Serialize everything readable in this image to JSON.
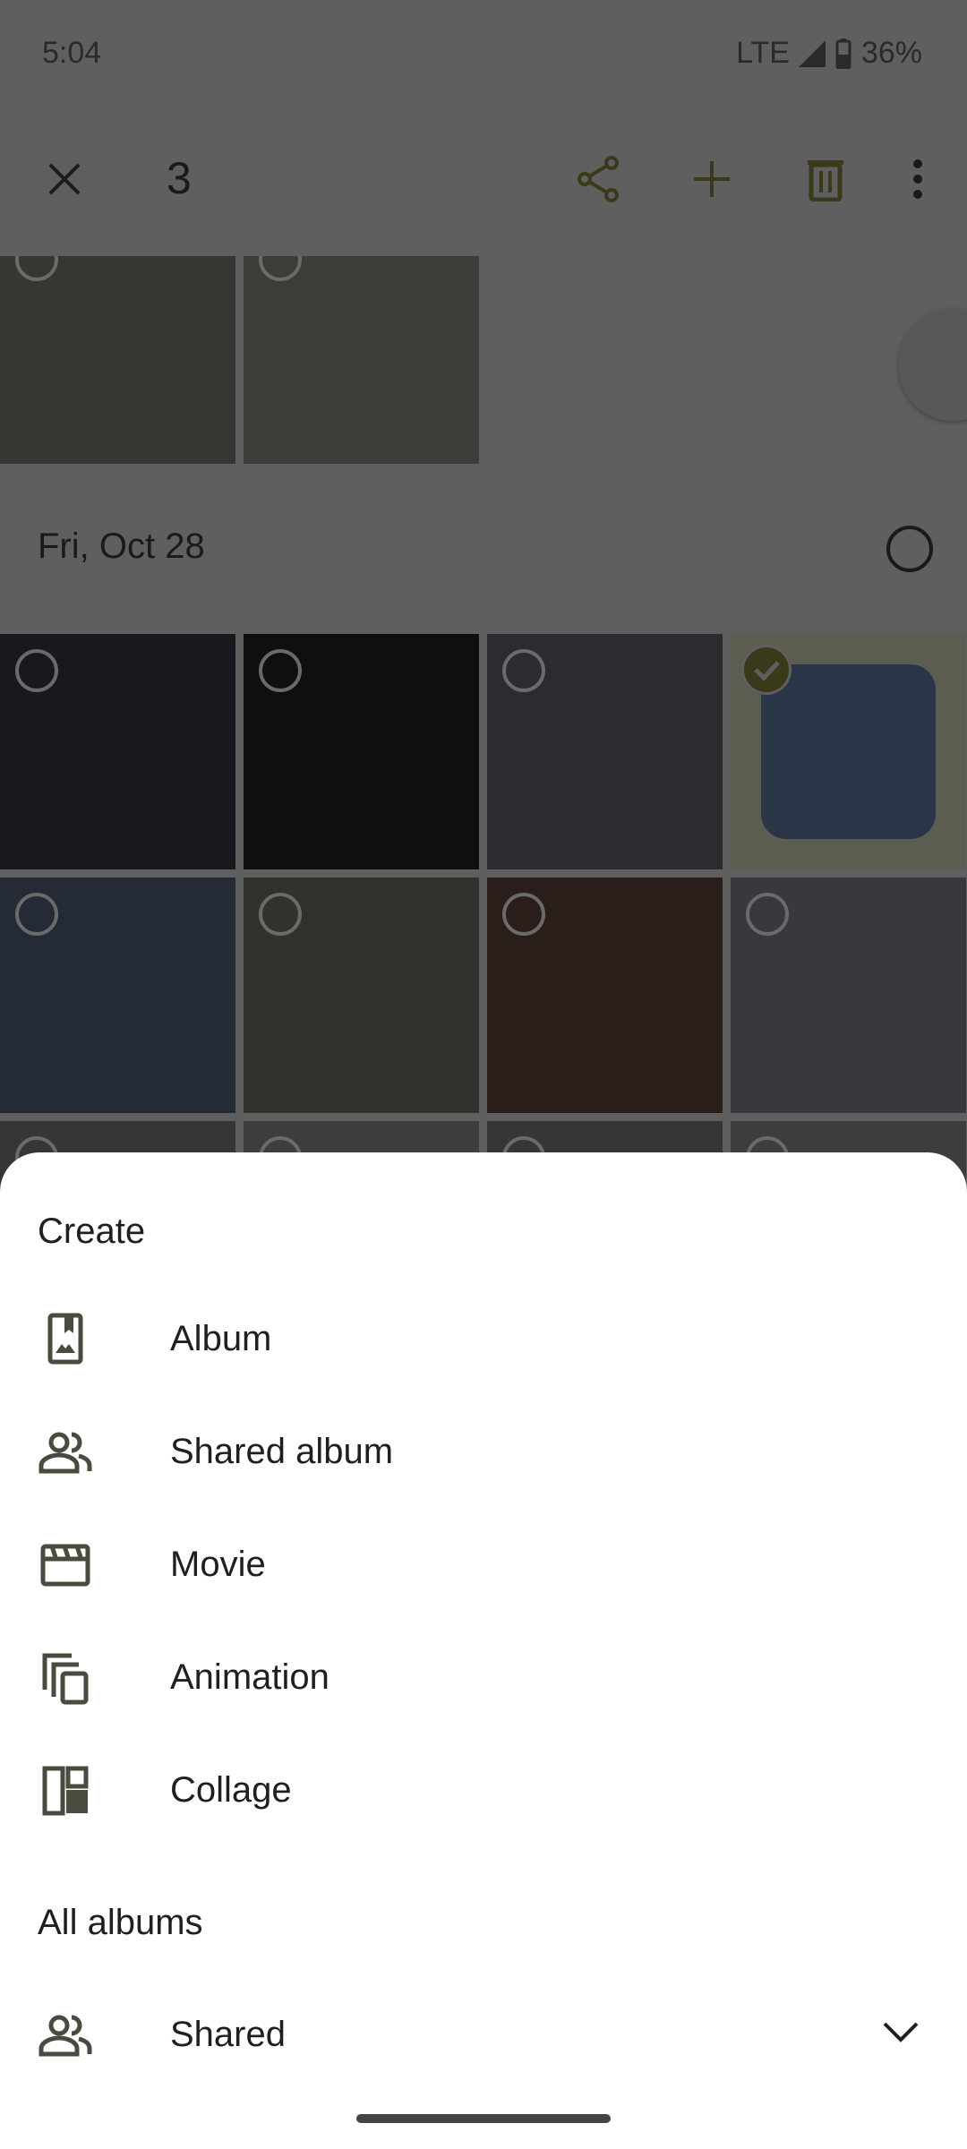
{
  "status_bar": {
    "time": "5:04",
    "network": "LTE",
    "battery": "36%"
  },
  "toolbar": {
    "selected_count": "3",
    "icons": [
      "close-icon",
      "share-icon",
      "add-icon",
      "delete-icon",
      "more-vert-icon"
    ]
  },
  "grid": {
    "top_row": [
      {
        "color": "#8a8880"
      },
      {
        "color": "#9a958c"
      }
    ],
    "date_header": "Fri, Oct 28",
    "rows": [
      [
        {
          "color": "#3a3f4a",
          "selected": false
        },
        {
          "color": "#2a2620",
          "selected": false
        },
        {
          "color": "#6a6e78",
          "selected": false
        },
        {
          "color": "#e8e6c8",
          "selected": true
        }
      ],
      [
        {
          "color": "#5a6a88",
          "selected": false
        },
        {
          "color": "#7a7a70",
          "selected": false
        },
        {
          "color": "#6a4a40",
          "selected": false
        },
        {
          "color": "#8a8e98",
          "selected": false
        }
      ],
      [
        {
          "color": "#888"
        },
        {
          "color": "#999"
        },
        {
          "color": "#888"
        },
        {
          "color": "#999"
        }
      ]
    ]
  },
  "sheet": {
    "create_title": "Create",
    "create_items": [
      {
        "label": "Album",
        "icon": "photo-album-icon"
      },
      {
        "label": "Shared album",
        "icon": "people-icon"
      },
      {
        "label": "Movie",
        "icon": "movie-icon"
      },
      {
        "label": "Animation",
        "icon": "animation-icon"
      },
      {
        "label": "Collage",
        "icon": "collage-icon"
      }
    ],
    "albums_title": "All albums",
    "albums_items": [
      {
        "label": "Shared",
        "icon": "people-icon"
      }
    ]
  },
  "colors": {
    "icon": "#4a4a3f",
    "accent": "#5a5a2a",
    "scrim": "rgba(0,0,0,0.63)"
  }
}
